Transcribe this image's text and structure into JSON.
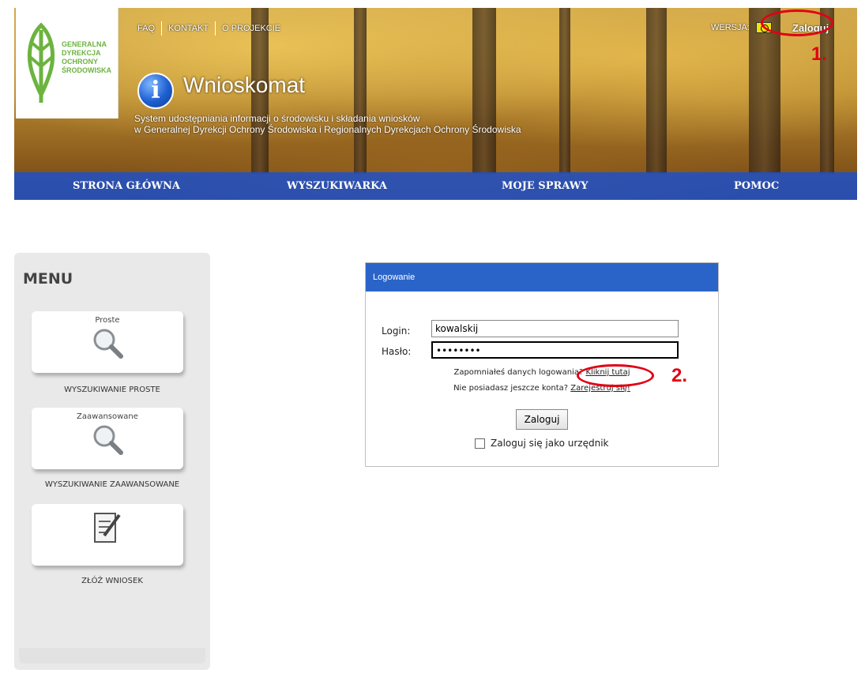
{
  "logo": {
    "lines": [
      "GENERALNA",
      "DYREKCJA",
      "OCHRONY",
      "ŚRODOWISKA"
    ]
  },
  "top_links": [
    "FAQ",
    "KONTAKT",
    "O PROJEKCIE"
  ],
  "version_label": "WERSJA:",
  "login_link": "Zaloguj",
  "annotation_1": "1.",
  "annotation_2": "2.",
  "app": {
    "title": "Wnioskomat",
    "subtitle_line1": "System udostępniania informacji o środowisku i składania wniosków",
    "subtitle_line2": "w Generalnej Dyrekcji Ochrony Środowiska i Regionalnych Dyrekcjach Ochrony Środowiska"
  },
  "nav": [
    "STRONA GŁÓWNA",
    "WYSZUKIWARKA",
    "MOJE SPRAWY",
    "POMOC"
  ],
  "sidebar": {
    "title": "MENU",
    "tiles": [
      {
        "label": "Proste",
        "caption": "WYSZUKIWANIE PROSTE",
        "icon": "magnifier-icon"
      },
      {
        "label": "Zaawansowane",
        "caption": "WYSZUKIWANIE ZAAWANSOWANE",
        "icon": "magnifier-icon"
      },
      {
        "label": "",
        "caption": "ZŁÓŻ WNIOSEK",
        "icon": "document-pen-icon"
      }
    ]
  },
  "login_panel": {
    "title": "Logowanie",
    "login_label": "Login:",
    "login_value": "kowalskij",
    "password_label": "Hasło:",
    "password_value": "••••••••",
    "forgot_text": "Zapomniałeś danych logowania?",
    "forgot_link": "Kliknij tutaj",
    "no_account_text": "Nie posiadasz jeszcze konta?",
    "register_link": "Zarejestruj się!",
    "submit_label": "Zaloguj",
    "official_checkbox_label": "Zaloguj się jako urzędnik"
  }
}
